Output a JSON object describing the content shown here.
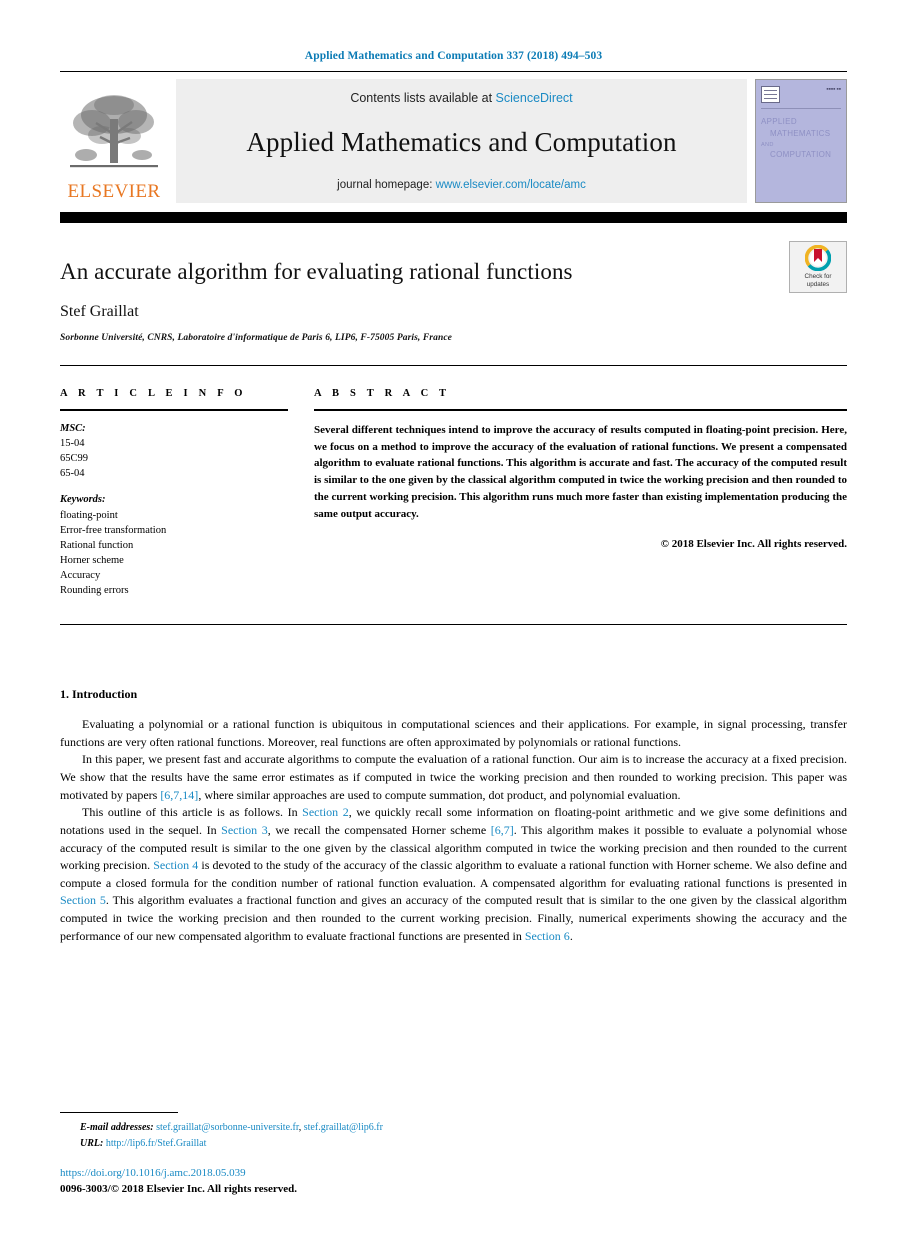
{
  "running_head": "Applied Mathematics and Computation 337 (2018) 494–503",
  "masthead": {
    "contents_prefix": "Contents lists available at ",
    "sciencedirect": "ScienceDirect",
    "journal_name": "Applied Mathematics and Computation",
    "homepage_prefix": "journal homepage: ",
    "homepage_url": "www.elsevier.com/locate/amc",
    "publisher_wordmark": "ELSEVIER",
    "cover": {
      "line1": "APPLIED",
      "line2": "MATHEMATICS",
      "line3": "AND",
      "line4": "COMPUTATION"
    },
    "link_color": "#1a8ac4",
    "elsevier_orange": "#E87722"
  },
  "title_block": {
    "title": "An accurate algorithm for evaluating rational functions",
    "author": "Stef Graillat",
    "affiliation": "Sorbonne Université, CNRS, Laboratoire d'informatique de Paris 6, LIP6, F-75005 Paris, France",
    "crossmark_line1": "Check for",
    "crossmark_line2": "updates"
  },
  "article_info": {
    "heading": "A R T I C L E   I N F O",
    "msc_label": "MSC:",
    "msc_codes": [
      "15-04",
      "65C99",
      "65-04"
    ],
    "keywords_label": "Keywords:",
    "keywords": [
      "floating-point",
      "Error-free transformation",
      "Rational function",
      "Horner scheme",
      "Accuracy",
      "Rounding errors"
    ]
  },
  "abstract": {
    "heading": "A B S T R A C T",
    "text": "Several different techniques intend to improve the accuracy of results computed in floating-point precision. Here, we focus on a method to improve the accuracy of the evaluation of rational functions. We present a compensated algorithm to evaluate rational functions. This algorithm is accurate and fast. The accuracy of the computed result is similar to the one given by the classical algorithm computed in twice the working precision and then rounded to the current working precision. This algorithm runs much more faster than existing implementation producing the same output accuracy.",
    "copyright": "© 2018 Elsevier Inc. All rights reserved."
  },
  "introduction": {
    "heading": "1. Introduction",
    "paragraph1": "Evaluating a polynomial or a rational function is ubiquitous in computational sciences and their applications. For example, in signal processing, transfer functions are very often rational functions. Moreover, real functions are often approximated by polynomials or rational functions.",
    "paragraph2_part1": "In this paper, we present fast and accurate algorithms to compute the evaluation of a rational function. Our aim is to increase the accuracy at a fixed precision. We show that the results have the same error estimates as if computed in twice the working precision and then rounded to working precision. This paper was motivated by papers ",
    "paragraph2_cite": "[6,7,14]",
    "paragraph2_part2": ", where similar approaches are used to compute summation, dot product, and polynomial evaluation.",
    "paragraph3_part1": "This outline of this article is as follows. In ",
    "p3_sec2": "Section 2",
    "paragraph3_part2": ", we quickly recall some information on floating-point arithmetic and we give some definitions and notations used in the sequel. In ",
    "p3_sec3": "Section 3",
    "paragraph3_part3": ", we recall the compensated Horner scheme ",
    "p3_cite67": "[6,7]",
    "paragraph3_part4": ". This algorithm makes it possible to evaluate a polynomial whose accuracy of the computed result is similar to the one given by the classical algorithm computed in twice the working precision and then rounded to the current working precision. ",
    "p3_sec4": "Section 4",
    "paragraph3_part5": " is devoted to the study of the accuracy of the classic algorithm to evaluate a rational function with Horner scheme. We also define and compute a closed formula for the condition number of rational function evaluation. A compensated algorithm for evaluating rational functions is presented in ",
    "p3_sec5": "Section 5",
    "paragraph3_part6": ". This algorithm evaluates a fractional function and gives an accuracy of the computed result that is similar to the one given by the classical algorithm computed in twice the working precision and then rounded to the current working precision. Finally, numerical experiments showing the accuracy and the performance of our new compensated algorithm to evaluate fractional functions are presented in ",
    "p3_sec6": "Section 6",
    "paragraph3_part7": "."
  },
  "footer": {
    "email_label": "E-mail addresses:",
    "email1": "stef.graillat@sorbonne-universite.fr",
    "email_sep": ", ",
    "email2": "stef.graillat@lip6.fr",
    "url_label": "URL:",
    "url": "http://lip6.fr/Stef.Graillat",
    "doi": "https://doi.org/10.1016/j.amc.2018.05.039",
    "issn_line": "0096-3003/© 2018 Elsevier Inc. All rights reserved."
  }
}
